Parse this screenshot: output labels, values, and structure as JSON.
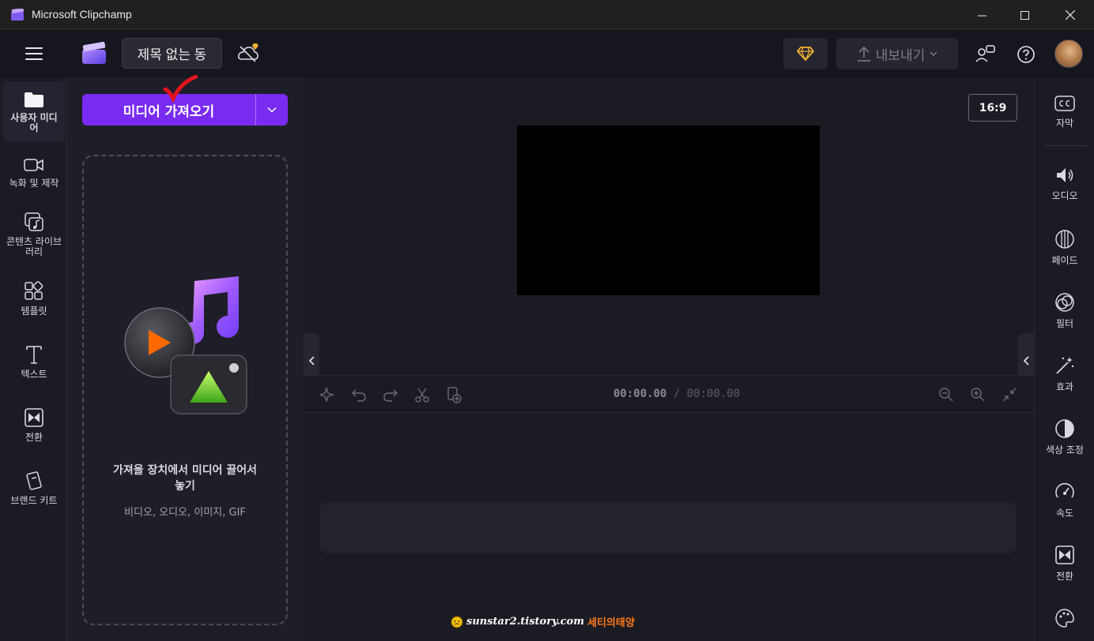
{
  "window": {
    "title": "Microsoft Clipchamp"
  },
  "header": {
    "doc_title": "제목 없는 동",
    "export_label": "내보내기",
    "colors": {
      "accent": "#7a2bf2",
      "premium": "#f2b233"
    }
  },
  "left_nav": {
    "items": [
      {
        "label": "사용자 미디어",
        "icon": "folder-icon"
      },
      {
        "label": "녹화 및 제작",
        "icon": "video-camera-icon"
      },
      {
        "label": "콘텐츠 라이브러리",
        "icon": "content-library-icon"
      },
      {
        "label": "템플릿",
        "icon": "templates-icon"
      },
      {
        "label": "텍스트",
        "icon": "text-icon"
      },
      {
        "label": "전환",
        "icon": "transition-icon"
      },
      {
        "label": "브랜드 키트",
        "icon": "brand-kit-icon"
      }
    ]
  },
  "media_panel": {
    "import_label": "미디어 가져오기",
    "drop_title": "가져올 장치에서 미디어 끌어서 놓기",
    "drop_formats": "비디오, 오디오, 이미지, GIF"
  },
  "preview": {
    "aspect_ratio": "16:9"
  },
  "timeline": {
    "current": "00:00.00",
    "total": "/ 00:00.00"
  },
  "right_nav": {
    "items": [
      {
        "label": "자막",
        "icon": "captions-icon"
      },
      {
        "label": "오디오",
        "icon": "speaker-icon"
      },
      {
        "label": "페이드",
        "icon": "fade-icon"
      },
      {
        "label": "필터",
        "icon": "filters-icon"
      },
      {
        "label": "효과",
        "icon": "magic-wand-icon"
      },
      {
        "label": "색상 조정",
        "icon": "contrast-icon"
      },
      {
        "label": "속도",
        "icon": "speedometer-icon"
      },
      {
        "label": "전환",
        "icon": "transition-icon"
      }
    ]
  },
  "watermark": {
    "url": "sunstar2.tistory.com",
    "name": "세티의태양"
  }
}
